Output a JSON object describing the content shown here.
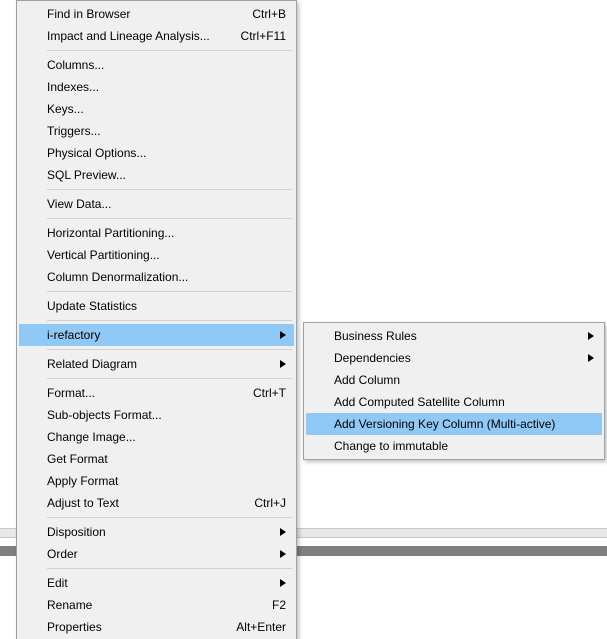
{
  "main_menu": {
    "groups": [
      [
        {
          "label": "Find in Browser",
          "shortcut": "Ctrl+B",
          "submenu": false
        },
        {
          "label": "Impact and Lineage Analysis...",
          "shortcut": "Ctrl+F11",
          "submenu": false
        }
      ],
      [
        {
          "label": "Columns...",
          "shortcut": "",
          "submenu": false
        },
        {
          "label": "Indexes...",
          "shortcut": "",
          "submenu": false
        },
        {
          "label": "Keys...",
          "shortcut": "",
          "submenu": false
        },
        {
          "label": "Triggers...",
          "shortcut": "",
          "submenu": false
        },
        {
          "label": "Physical Options...",
          "shortcut": "",
          "submenu": false
        },
        {
          "label": "SQL Preview...",
          "shortcut": "",
          "submenu": false
        }
      ],
      [
        {
          "label": "View Data...",
          "shortcut": "",
          "submenu": false
        }
      ],
      [
        {
          "label": "Horizontal Partitioning...",
          "shortcut": "",
          "submenu": false
        },
        {
          "label": "Vertical Partitioning...",
          "shortcut": "",
          "submenu": false
        },
        {
          "label": "Column Denormalization...",
          "shortcut": "",
          "submenu": false
        }
      ],
      [
        {
          "label": "Update Statistics",
          "shortcut": "",
          "submenu": false
        }
      ],
      [
        {
          "label": "i-refactory",
          "shortcut": "",
          "submenu": true,
          "highlight": true
        }
      ],
      [
        {
          "label": "Related Diagram",
          "shortcut": "",
          "submenu": true
        }
      ],
      [
        {
          "label": "Format...",
          "shortcut": "Ctrl+T",
          "submenu": false
        },
        {
          "label": "Sub-objects Format...",
          "shortcut": "",
          "submenu": false
        },
        {
          "label": "Change Image...",
          "shortcut": "",
          "submenu": false
        },
        {
          "label": "Get Format",
          "shortcut": "",
          "submenu": false
        },
        {
          "label": "Apply Format",
          "shortcut": "",
          "submenu": false
        },
        {
          "label": "Adjust to Text",
          "shortcut": "Ctrl+J",
          "submenu": false
        }
      ],
      [
        {
          "label": "Disposition",
          "shortcut": "",
          "submenu": true
        },
        {
          "label": "Order",
          "shortcut": "",
          "submenu": true
        }
      ],
      [
        {
          "label": "Edit",
          "shortcut": "",
          "submenu": true
        },
        {
          "label": "Rename",
          "shortcut": "F2",
          "submenu": false
        },
        {
          "label": "Properties",
          "shortcut": "Alt+Enter",
          "submenu": false
        }
      ]
    ]
  },
  "sub_menu": {
    "groups": [
      [
        {
          "label": "Business Rules",
          "shortcut": "",
          "submenu": true
        },
        {
          "label": "Dependencies",
          "shortcut": "",
          "submenu": true
        },
        {
          "label": "Add Column",
          "shortcut": "",
          "submenu": false
        },
        {
          "label": "Add Computed Satellite Column",
          "shortcut": "",
          "submenu": false
        },
        {
          "label": "Add Versioning Key Column (Multi-active)",
          "shortcut": "",
          "submenu": false,
          "highlight": true
        },
        {
          "label": "Change to immutable",
          "shortcut": "",
          "submenu": false
        }
      ]
    ]
  },
  "colors": {
    "highlight": "#90c8f6",
    "menu_bg": "#f0f0f0",
    "border": "#a0a0a0"
  }
}
